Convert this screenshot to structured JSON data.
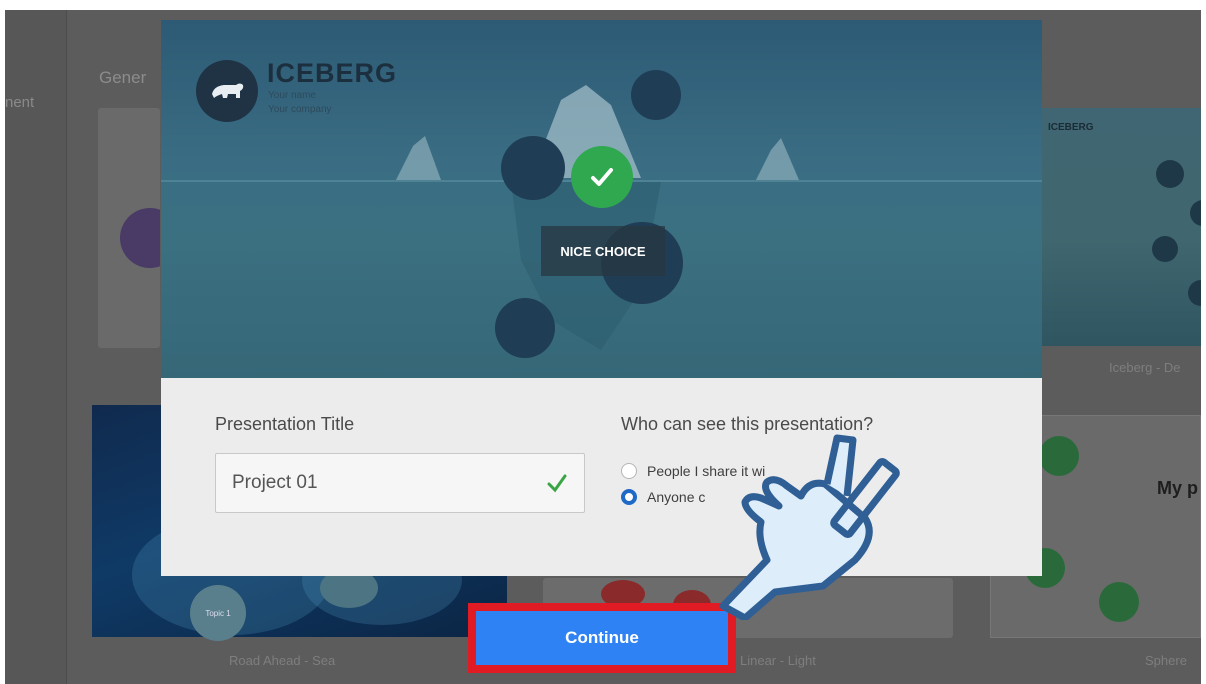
{
  "background": {
    "side_nav_label": "nent",
    "section_title": "Gener",
    "cards": [
      {
        "caption": "Road Ahead - Sea"
      },
      {
        "caption": "Linear - Light"
      },
      {
        "caption": "Iceberg - De"
      },
      {
        "caption": "Sphere"
      }
    ],
    "iceberg_thumb_title": "ICEBERG",
    "sphere_thumb_text": "My p",
    "road_thumb_topic": "Topic 1"
  },
  "modal": {
    "template_title": "ICEBERG",
    "template_name_line": "Your name",
    "template_company_line": "Your company",
    "overlay_label": "NICE CHOICE",
    "presentation_title_label": "Presentation Title",
    "presentation_title_value": "Project 01",
    "visibility_label": "Who can see this presentation?",
    "visibility_options": [
      {
        "label": "People I share it wi",
        "selected": false
      },
      {
        "label": "Anyone c",
        "selected": true
      }
    ]
  },
  "continue_button": {
    "label": "Continue"
  },
  "colors": {
    "accent_blue": "#2f82f4",
    "highlight_red": "#e01b24",
    "success_green": "#2fa84f",
    "radio_blue": "#1f69c7"
  },
  "icons": [
    "polar-bear-logo-icon",
    "checkmark-icon",
    "pointing-hand-icon"
  ]
}
